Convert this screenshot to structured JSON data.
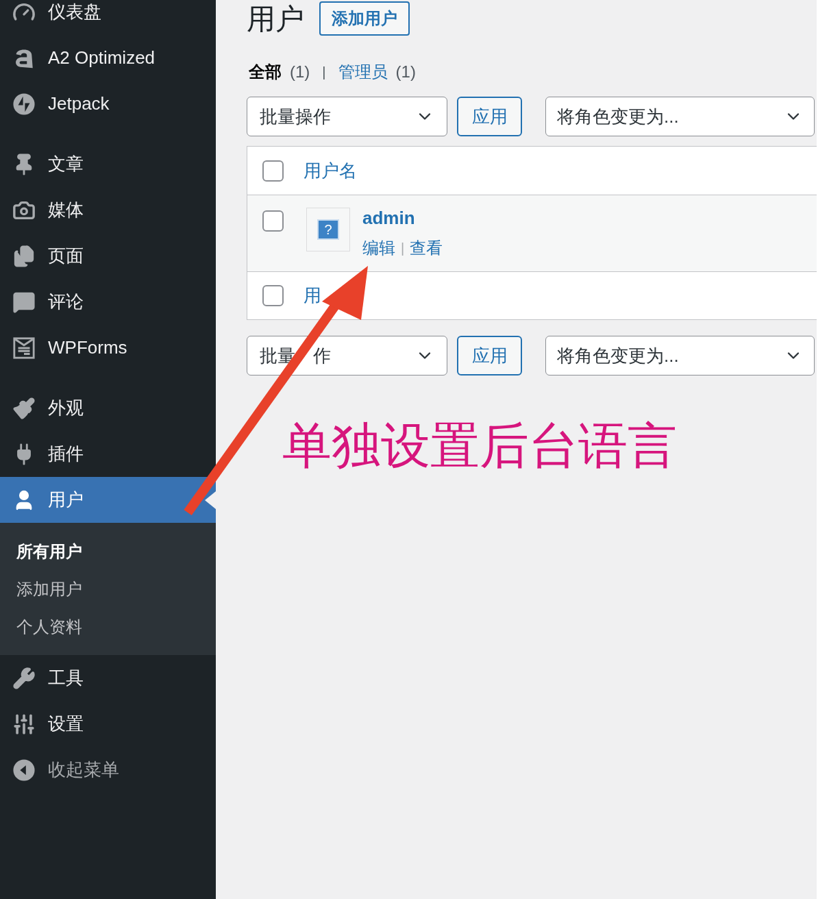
{
  "sidebar": {
    "groups": [
      [
        {
          "label": "仪表盘",
          "selected": false
        },
        {
          "label": "A2 Optimized",
          "selected": false
        },
        {
          "label": "Jetpack",
          "selected": false
        }
      ],
      [
        {
          "label": "文章",
          "selected": false
        },
        {
          "label": "媒体",
          "selected": false
        },
        {
          "label": "页面",
          "selected": false
        },
        {
          "label": "评论",
          "selected": false
        },
        {
          "label": "WPForms",
          "selected": false
        }
      ],
      [
        {
          "label": "外观",
          "selected": false
        },
        {
          "label": "插件",
          "selected": false
        },
        {
          "label": "用户",
          "selected": true,
          "children": [
            {
              "label": "所有用户",
              "selected": true
            },
            {
              "label": "添加用户",
              "selected": false
            },
            {
              "label": "个人资料",
              "selected": false
            }
          ]
        },
        {
          "label": "工具",
          "selected": false
        },
        {
          "label": "设置",
          "selected": false
        },
        {
          "label": "收起菜单",
          "selected": false,
          "kind": "collapse"
        }
      ]
    ]
  },
  "page": {
    "title": "用户",
    "add_button": "添加用户"
  },
  "filters": {
    "separator": "|",
    "items": [
      {
        "label": "全部",
        "count": "(1)",
        "selected": true
      },
      {
        "label": "管理员",
        "count": "(1)",
        "selected": false
      }
    ]
  },
  "top_actions": {
    "bulk": "批量操作",
    "apply": "应用",
    "role": "将角色变更为..."
  },
  "table": {
    "header": {
      "label": "用户名",
      "checked": false
    },
    "rows": [
      {
        "username": "admin",
        "avatar_glyph": "?",
        "actions": [
          "编辑",
          "查看"
        ],
        "action_separator": "|",
        "checked": false
      }
    ],
    "footer": {
      "label": "用",
      "checked": false
    }
  },
  "bottom_actions": {
    "bulk": "批量",
    "bulk_tail": "作",
    "apply": "应用",
    "role": "将角色变更为..."
  },
  "annotation": {
    "text": "单独设置后台语言"
  }
}
